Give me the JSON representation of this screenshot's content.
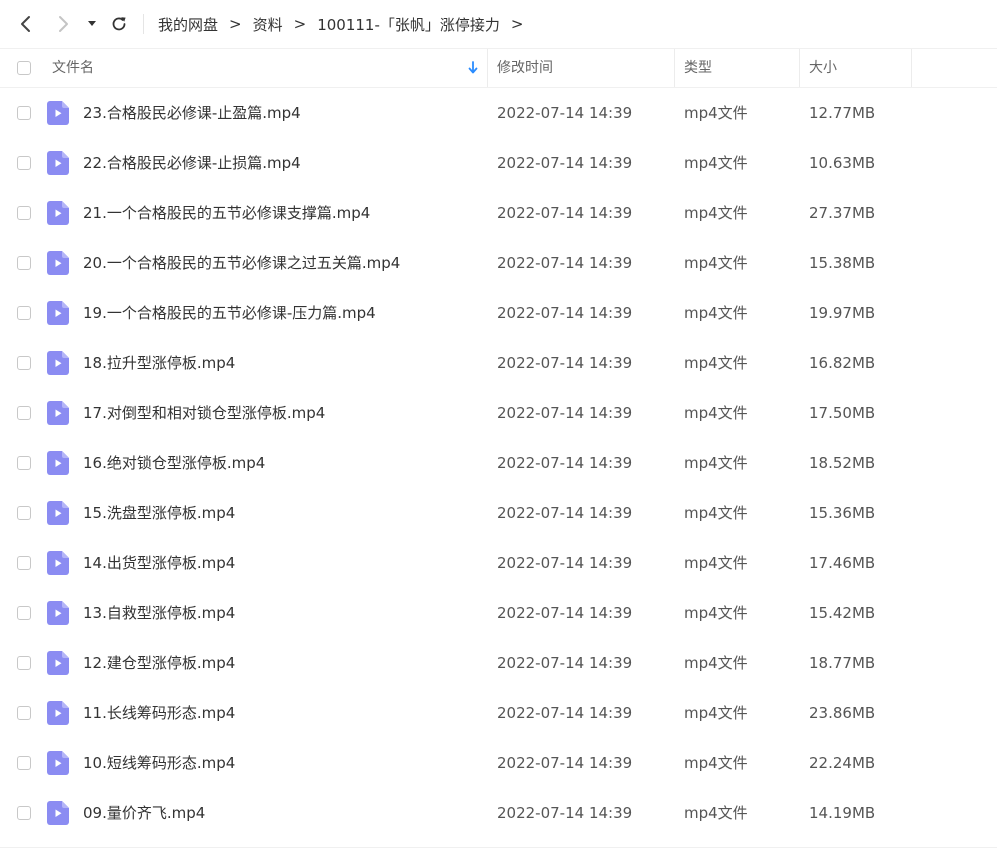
{
  "toolbar": {
    "back_icon": "chevron-left-icon",
    "forward_icon": "chevron-right-icon",
    "dropdown_icon": "caret-down-icon",
    "refresh_icon": "refresh-icon"
  },
  "breadcrumb": {
    "items": [
      "我的网盘",
      "资料",
      "100111-「张帆」涨停接力"
    ],
    "separator": ">"
  },
  "columns": {
    "name": "文件名",
    "modified": "修改时间",
    "type": "类型",
    "size": "大小",
    "sort_icon": "arrow-down-icon",
    "sort_color": "#2a8cff"
  },
  "file_icon": {
    "name": "video-file-icon",
    "color": "#8b8cf2"
  },
  "files": [
    {
      "name": "23.合格股民必修课-止盈篇.mp4",
      "modified": "2022-07-14 14:39",
      "type": "mp4文件",
      "size": "12.77MB"
    },
    {
      "name": "22.合格股民必修课-止损篇.mp4",
      "modified": "2022-07-14 14:39",
      "type": "mp4文件",
      "size": "10.63MB"
    },
    {
      "name": "21.一个合格股民的五节必修课支撑篇.mp4",
      "modified": "2022-07-14 14:39",
      "type": "mp4文件",
      "size": "27.37MB"
    },
    {
      "name": "20.一个合格股民的五节必修课之过五关篇.mp4",
      "modified": "2022-07-14 14:39",
      "type": "mp4文件",
      "size": "15.38MB"
    },
    {
      "name": "19.一个合格股民的五节必修课-压力篇.mp4",
      "modified": "2022-07-14 14:39",
      "type": "mp4文件",
      "size": "19.97MB"
    },
    {
      "name": "18.拉升型涨停板.mp4",
      "modified": "2022-07-14 14:39",
      "type": "mp4文件",
      "size": "16.82MB"
    },
    {
      "name": "17.对倒型和相对锁仓型涨停板.mp4",
      "modified": "2022-07-14 14:39",
      "type": "mp4文件",
      "size": "17.50MB"
    },
    {
      "name": "16.绝对锁仓型涨停板.mp4",
      "modified": "2022-07-14 14:39",
      "type": "mp4文件",
      "size": "18.52MB"
    },
    {
      "name": "15.洗盘型涨停板.mp4",
      "modified": "2022-07-14 14:39",
      "type": "mp4文件",
      "size": "15.36MB"
    },
    {
      "name": "14.出货型涨停板.mp4",
      "modified": "2022-07-14 14:39",
      "type": "mp4文件",
      "size": "17.46MB"
    },
    {
      "name": "13.自救型涨停板.mp4",
      "modified": "2022-07-14 14:39",
      "type": "mp4文件",
      "size": "15.42MB"
    },
    {
      "name": "12.建仓型涨停板.mp4",
      "modified": "2022-07-14 14:39",
      "type": "mp4文件",
      "size": "18.77MB"
    },
    {
      "name": "11.长线筹码形态.mp4",
      "modified": "2022-07-14 14:39",
      "type": "mp4文件",
      "size": "23.86MB"
    },
    {
      "name": "10.短线筹码形态.mp4",
      "modified": "2022-07-14 14:39",
      "type": "mp4文件",
      "size": "22.24MB"
    },
    {
      "name": "09.量价齐飞.mp4",
      "modified": "2022-07-14 14:39",
      "type": "mp4文件",
      "size": "14.19MB"
    }
  ]
}
